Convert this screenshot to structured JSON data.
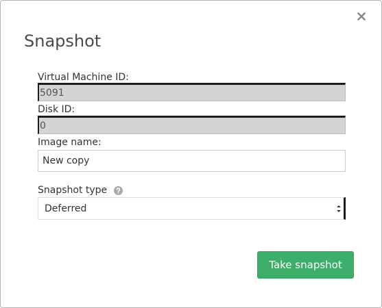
{
  "dialog": {
    "title": "Snapshot",
    "close_icon": "close-icon"
  },
  "form": {
    "vm_id": {
      "label": "Virtual Machine ID:",
      "value": "5091"
    },
    "disk_id": {
      "label": "Disk ID:",
      "value": "0"
    },
    "image_name": {
      "label": "Image name:",
      "value": "New copy"
    },
    "snapshot_type": {
      "label": "Snapshot type",
      "help_icon": "question-circle-icon",
      "selected": "Deferred"
    }
  },
  "actions": {
    "submit_label": "Take snapshot"
  },
  "colors": {
    "primary": "#3cae6a",
    "title_text": "#4a4a4a",
    "readonly_bg": "#d4d4d4"
  }
}
